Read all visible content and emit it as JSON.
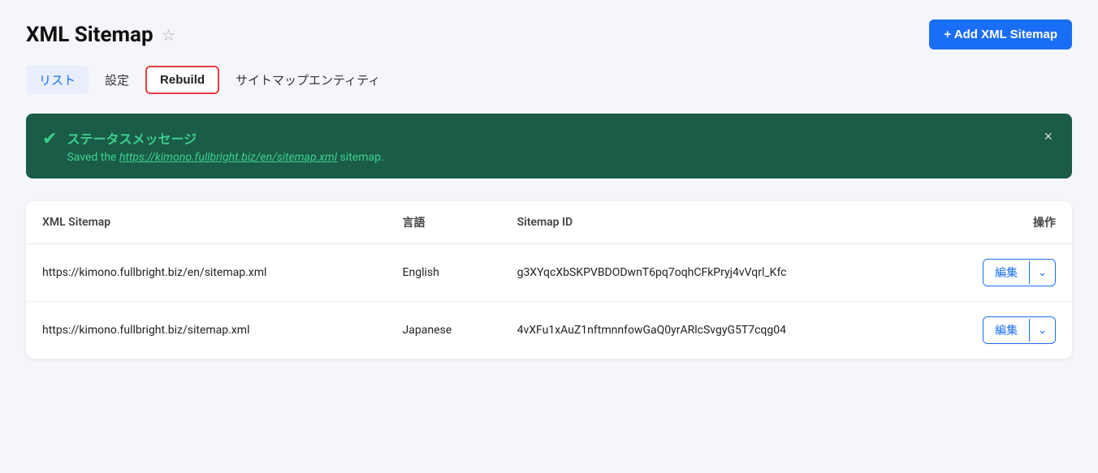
{
  "page": {
    "title": "XML Sitemap",
    "star_icon": "☆",
    "add_button_label": "+ Add XML Sitemap"
  },
  "tabs": [
    {
      "id": "list",
      "label": "リスト",
      "active": true,
      "rebuild": false
    },
    {
      "id": "settings",
      "label": "設定",
      "active": false,
      "rebuild": false
    },
    {
      "id": "rebuild",
      "label": "Rebuild",
      "active": false,
      "rebuild": true
    },
    {
      "id": "sitemap-entity",
      "label": "サイトマップエンティティ",
      "active": false,
      "rebuild": false
    }
  ],
  "status_banner": {
    "title": "ステータスメッセージ",
    "message_prefix": "Saved the ",
    "link_text": "https://kimono.fullbright.biz/en/sitemap.xml",
    "message_suffix": " sitemap.",
    "close_icon": "×"
  },
  "table": {
    "columns": [
      {
        "id": "xml_sitemap",
        "label": "XML Sitemap"
      },
      {
        "id": "language",
        "label": "言語"
      },
      {
        "id": "sitemap_id",
        "label": "Sitemap ID"
      },
      {
        "id": "actions",
        "label": "操作"
      }
    ],
    "rows": [
      {
        "xml_sitemap": "https://kimono.fullbright.biz/en/sitemap.xml",
        "language": "English",
        "sitemap_id": "g3XYqcXbSKPVBDODwnT6pq7oqhCFkPryj4vVqrl_Kfc",
        "edit_label": "編集"
      },
      {
        "xml_sitemap": "https://kimono.fullbright.biz/sitemap.xml",
        "language": "Japanese",
        "sitemap_id": "4vXFu1xAuZ1nftmnnfowGaQ0yrARlcSvgyG5T7cqg04",
        "edit_label": "編集"
      }
    ]
  }
}
